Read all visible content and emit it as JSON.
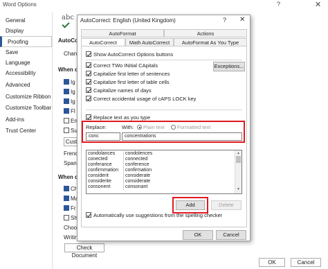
{
  "word_options": {
    "title": "Word Options",
    "help_glyph": "?",
    "close_glyph": "✕",
    "nav": [
      "General",
      "Display",
      "Proofing",
      "Save",
      "Language",
      "Accessibility",
      "Advanced",
      "Customize Ribbon",
      "Customize Toolbar",
      "Add-ins",
      "Trust Center"
    ],
    "active_nav": "Proofing",
    "abc_icon": "abc",
    "bg_fragments": {
      "autocorrect_heading": "AutoCo",
      "change_text": "Chang",
      "when_heading_1": "When c",
      "ig1": "Ig",
      "ig2": "Ig",
      "ig3": "Ig",
      "fl": "Fl",
      "en": "En",
      "su": "Su",
      "cust_btn": "Cust",
      "french": "French",
      "spanish": "Spani",
      "when_heading_2": "When c",
      "ch": "Ch",
      "ma": "Ma",
      "fr": "Fr",
      "sh": "Sh",
      "writing": "Writin",
      "choose": "Choos",
      "check_document": "Check Document",
      "ok": "OK",
      "cancel": "Cancel"
    }
  },
  "dialog": {
    "title": "AutoCorrect: English (United Kingdom)",
    "help_glyph": "?",
    "close_glyph": "✕",
    "tabs_row1": [
      "AutoFormat",
      "Actions"
    ],
    "tabs_row2": [
      "AutoCorrect",
      "Math AutoCorrect",
      "AutoFormat As You Type"
    ],
    "active_tab": "AutoCorrect",
    "show_options_button": "Show AutoCorrect Options buttons",
    "options": [
      {
        "label": "Correct TWo INitial CApitals",
        "checked": true
      },
      {
        "label": "Capitalize first letter of sentences",
        "checked": true
      },
      {
        "label": "Capitalize first letter of table cells",
        "checked": true
      },
      {
        "label": "Capitalize names of days",
        "checked": true
      },
      {
        "label": "Correct accidental usage of cAPS LOCK key",
        "checked": true
      }
    ],
    "exceptions_button": "Exceptions...",
    "replace_as_you_type": "Replace text as you type",
    "replace_label": "Replace:",
    "with_label": "With:",
    "plain_text": "Plain text",
    "formatted_text": "Formatted text",
    "replace_value": "conc",
    "with_value": "concentrations",
    "list": [
      [
        "condolances",
        "condolences"
      ],
      [
        "conected",
        "connected"
      ],
      [
        "conferance",
        "conference"
      ],
      [
        "confirmmation",
        "confirmation"
      ],
      [
        "considerit",
        "considerate"
      ],
      [
        "considerite",
        "considerate"
      ],
      [
        "consonent",
        "consonant"
      ]
    ],
    "add_button": "Add",
    "delete_button": "Delete",
    "auto_suggest": "Automatically use suggestions from the spelling checker",
    "ok_button": "OK",
    "cancel_button": "Cancel"
  },
  "colors": {
    "highlight": "#e0191e",
    "accent": "#2b579a"
  }
}
